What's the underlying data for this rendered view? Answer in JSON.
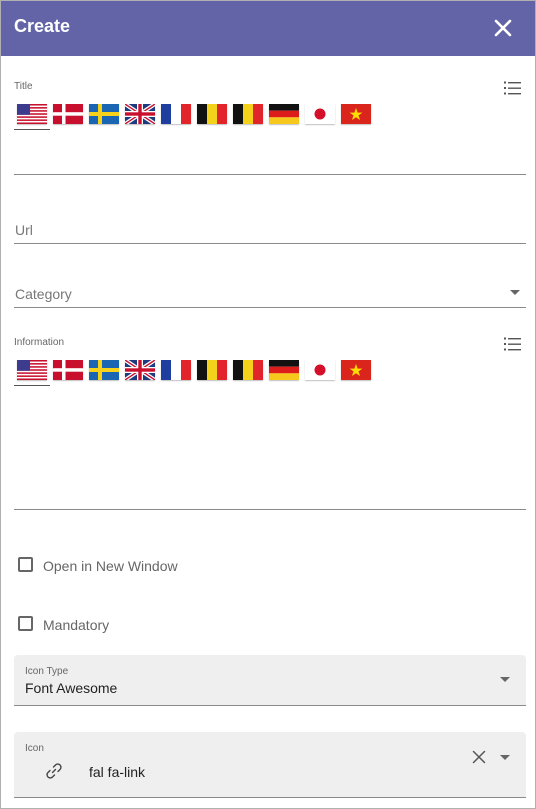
{
  "dialog": {
    "title": "Create"
  },
  "title_field": {
    "label": "Title",
    "languages": [
      "en-US",
      "da",
      "sv",
      "en-GB",
      "fr",
      "be",
      "be",
      "de",
      "ja",
      "vi"
    ],
    "value": ""
  },
  "url_field": {
    "placeholder": "Url"
  },
  "category_field": {
    "placeholder": "Category"
  },
  "information_field": {
    "label": "Information",
    "languages": [
      "en-US",
      "da",
      "sv",
      "en-GB",
      "fr",
      "be",
      "be",
      "de",
      "ja",
      "vi"
    ],
    "value": ""
  },
  "options": {
    "open_new_window": {
      "label": "Open in New Window",
      "checked": false
    },
    "mandatory": {
      "label": "Mandatory",
      "checked": false
    }
  },
  "icon_type": {
    "label": "Icon Type",
    "value": "Font Awesome"
  },
  "icon": {
    "label": "Icon",
    "value": "fal fa-link",
    "glyph": "link-icon"
  },
  "colors": {
    "header": "#6264a7",
    "field_bg": "#efefef"
  }
}
